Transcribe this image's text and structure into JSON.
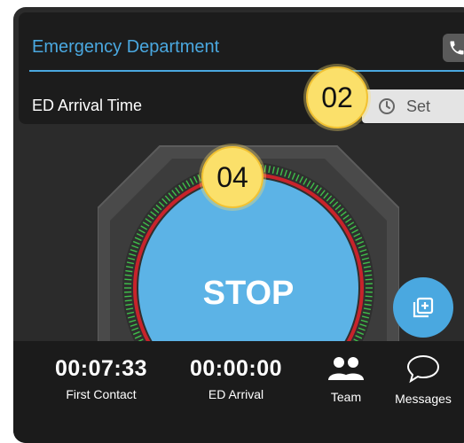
{
  "ed_section": {
    "title": "Emergency Department",
    "arrival_label": "ED Arrival Time",
    "set_label": "Set"
  },
  "badges": {
    "top": "02",
    "stop": "04"
  },
  "stop_button": {
    "label": "STOP"
  },
  "bottom_bar": {
    "first_contact": {
      "value": "00:07:33",
      "label": "First Contact"
    },
    "ed_arrival": {
      "value": "00:00:00",
      "label": "ED Arrival"
    },
    "team_label": "Team",
    "messages_label": "Messages"
  },
  "colors": {
    "accent_blue": "#4aa8e0",
    "badge_yellow": "#fbe06a",
    "ring_red": "#c8232b",
    "ring_green": "#3fbf4a"
  },
  "icons": [
    "phone-icon",
    "clock-icon",
    "add-note-icon",
    "team-icon",
    "messages-icon"
  ]
}
